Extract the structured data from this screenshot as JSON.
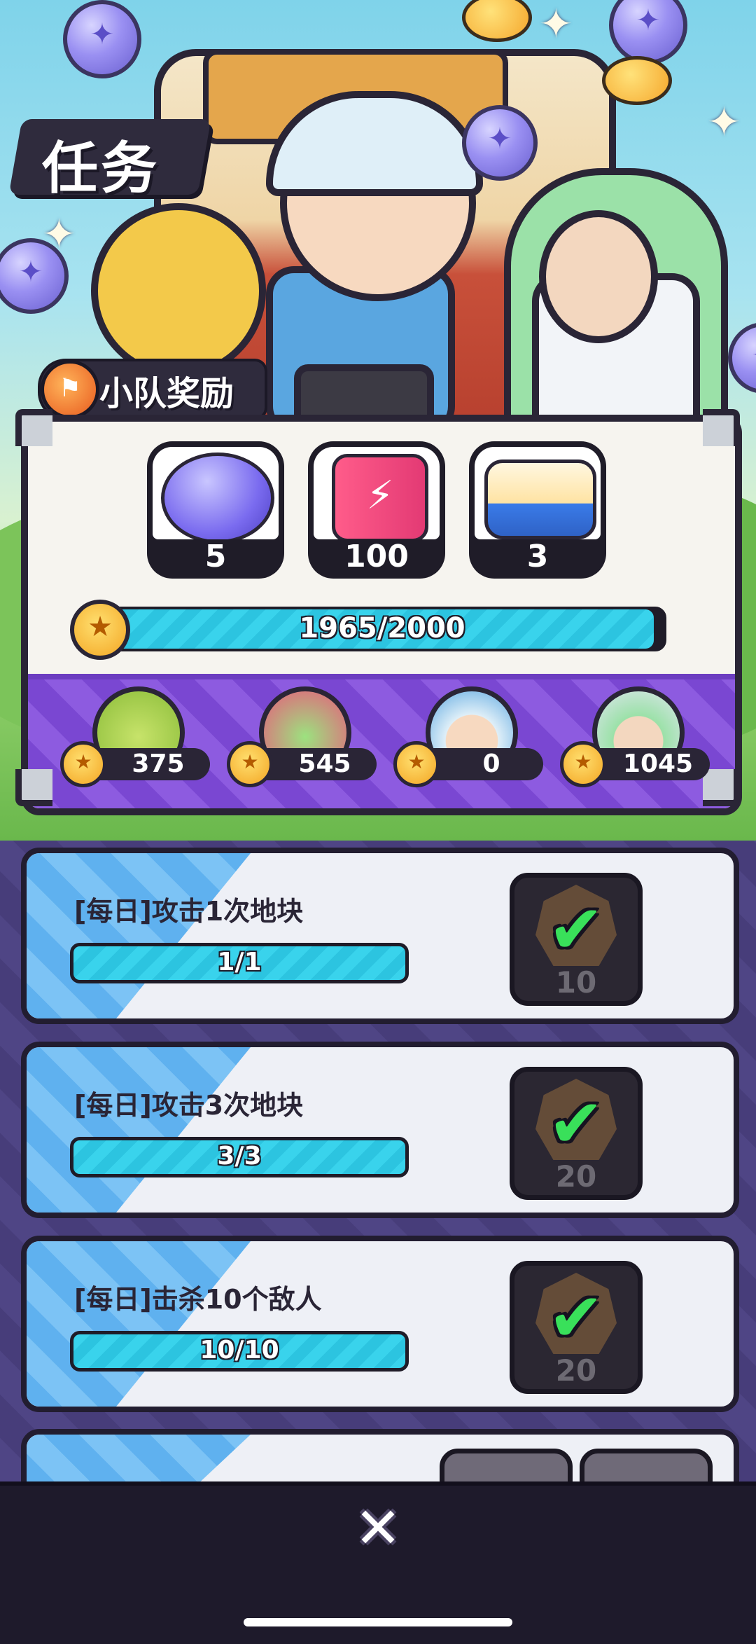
{
  "screen_title": "任务",
  "squad_rewards": {
    "label": "小队奖励",
    "items": [
      {
        "icon": "capsule-icon",
        "quantity": "5"
      },
      {
        "icon": "energy-can-icon",
        "quantity": "100"
      },
      {
        "icon": "lunchbox-icon",
        "quantity": "3"
      }
    ],
    "progress": {
      "text": "1965/2000",
      "fraction": 0.9825
    }
  },
  "members": [
    {
      "avatar": "pear-character-avatar",
      "score": "375"
    },
    {
      "avatar": "green-cat-avatar",
      "score": "545"
    },
    {
      "avatar": "boy-avatar",
      "score": "0"
    },
    {
      "avatar": "scientist-avatar",
      "score": "1045"
    }
  ],
  "tasks": [
    {
      "title": "[每日]攻击1次地块",
      "progress": "1/1",
      "reward": "10",
      "completed": true
    },
    {
      "title": "[每日]攻击3次地块",
      "progress": "3/3",
      "reward": "20",
      "completed": true
    },
    {
      "title": "[每日]击杀10个敌人",
      "progress": "10/10",
      "reward": "20",
      "completed": true
    }
  ],
  "close_icon": "close-icon",
  "colors": {
    "accent": "#39d3ec",
    "panel_purple": "#8d5be0",
    "check": "#39e05a"
  }
}
